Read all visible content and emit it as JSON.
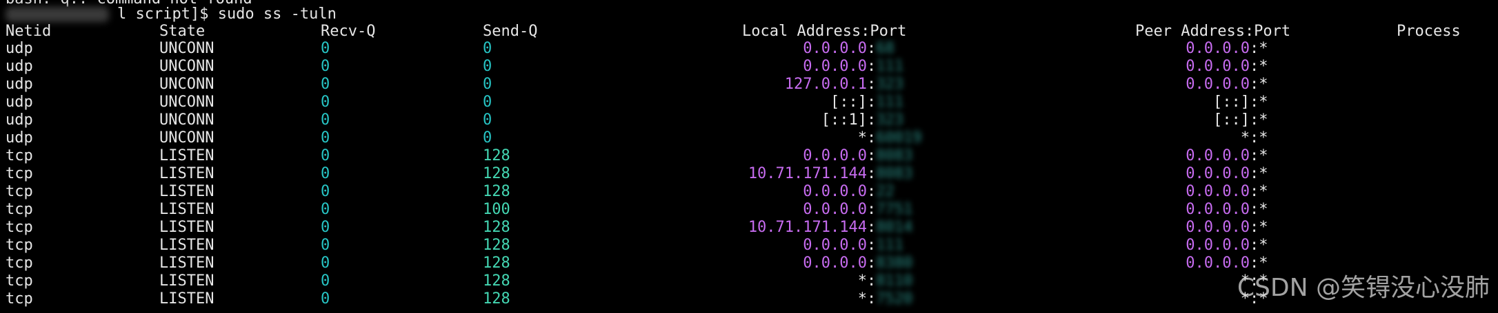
{
  "colors": {
    "background": "#000000",
    "text": "#e6e6e6",
    "queue_zero": "#27c5c5",
    "queue_nonzero": "#44d7b3",
    "address": "#c76cf0",
    "port_blur": "#2a8f87"
  },
  "terminal": {
    "previous_output": "bash: q.: command not found",
    "prompt": "l script]$ sudo ss -tuln",
    "headers": {
      "netid": "Netid",
      "state": "State",
      "recvq": "Recv-Q",
      "sendq": "Send-Q",
      "local": "Local Address:Port",
      "peer": "Peer Address:Port",
      "process": "Process"
    },
    "rows": [
      {
        "netid": "udp",
        "state": "UNCONN",
        "recvq": "0",
        "sendq": "0",
        "local_addr": "0.0.0.0",
        "local_port": "68",
        "peer_addr": "0.0.0.0",
        "peer_port": "*"
      },
      {
        "netid": "udp",
        "state": "UNCONN",
        "recvq": "0",
        "sendq": "0",
        "local_addr": "0.0.0.0",
        "local_port": "111",
        "peer_addr": "0.0.0.0",
        "peer_port": "*"
      },
      {
        "netid": "udp",
        "state": "UNCONN",
        "recvq": "0",
        "sendq": "0",
        "local_addr": "127.0.0.1",
        "local_port": "323",
        "peer_addr": "0.0.0.0",
        "peer_port": "*"
      },
      {
        "netid": "udp",
        "state": "UNCONN",
        "recvq": "0",
        "sendq": "0",
        "local_addr": "[::]",
        "local_port": "111",
        "peer_addr": "[::]",
        "peer_port": "*"
      },
      {
        "netid": "udp",
        "state": "UNCONN",
        "recvq": "0",
        "sendq": "0",
        "local_addr": "[::1]",
        "local_port": "323",
        "peer_addr": "[::]",
        "peer_port": "*"
      },
      {
        "netid": "udp",
        "state": "UNCONN",
        "recvq": "0",
        "sendq": "0",
        "local_addr": "*",
        "local_port": "60019",
        "peer_addr": "*",
        "peer_port": "*"
      },
      {
        "netid": "tcp",
        "state": "LISTEN",
        "recvq": "0",
        "sendq": "128",
        "local_addr": "0.0.0.0",
        "local_port": "8083",
        "peer_addr": "0.0.0.0",
        "peer_port": "*"
      },
      {
        "netid": "tcp",
        "state": "LISTEN",
        "recvq": "0",
        "sendq": "128",
        "local_addr": "10.71.171.144",
        "local_port": "8083",
        "peer_addr": "0.0.0.0",
        "peer_port": "*"
      },
      {
        "netid": "tcp",
        "state": "LISTEN",
        "recvq": "0",
        "sendq": "128",
        "local_addr": "0.0.0.0",
        "local_port": "22",
        "peer_addr": "0.0.0.0",
        "peer_port": "*"
      },
      {
        "netid": "tcp",
        "state": "LISTEN",
        "recvq": "0",
        "sendq": "100",
        "local_addr": "0.0.0.0",
        "local_port": "7751",
        "peer_addr": "0.0.0.0",
        "peer_port": "*"
      },
      {
        "netid": "tcp",
        "state": "LISTEN",
        "recvq": "0",
        "sendq": "128",
        "local_addr": "10.71.171.144",
        "local_port": "8014",
        "peer_addr": "0.0.0.0",
        "peer_port": "*"
      },
      {
        "netid": "tcp",
        "state": "LISTEN",
        "recvq": "0",
        "sendq": "128",
        "local_addr": "0.0.0.0",
        "local_port": "111",
        "peer_addr": "0.0.0.0",
        "peer_port": "*"
      },
      {
        "netid": "tcp",
        "state": "LISTEN",
        "recvq": "0",
        "sendq": "128",
        "local_addr": "0.0.0.0",
        "local_port": "8380",
        "peer_addr": "0.0.0.0",
        "peer_port": "*"
      },
      {
        "netid": "tcp",
        "state": "LISTEN",
        "recvq": "0",
        "sendq": "128",
        "local_addr": "*",
        "local_port": "8110",
        "peer_addr": "*",
        "peer_port": "*"
      },
      {
        "netid": "tcp",
        "state": "LISTEN",
        "recvq": "0",
        "sendq": "128",
        "local_addr": "*",
        "local_port": "7520",
        "peer_addr": "*",
        "peer_port": "*"
      }
    ]
  },
  "watermark": "CSDN @笑锝没心没肺"
}
